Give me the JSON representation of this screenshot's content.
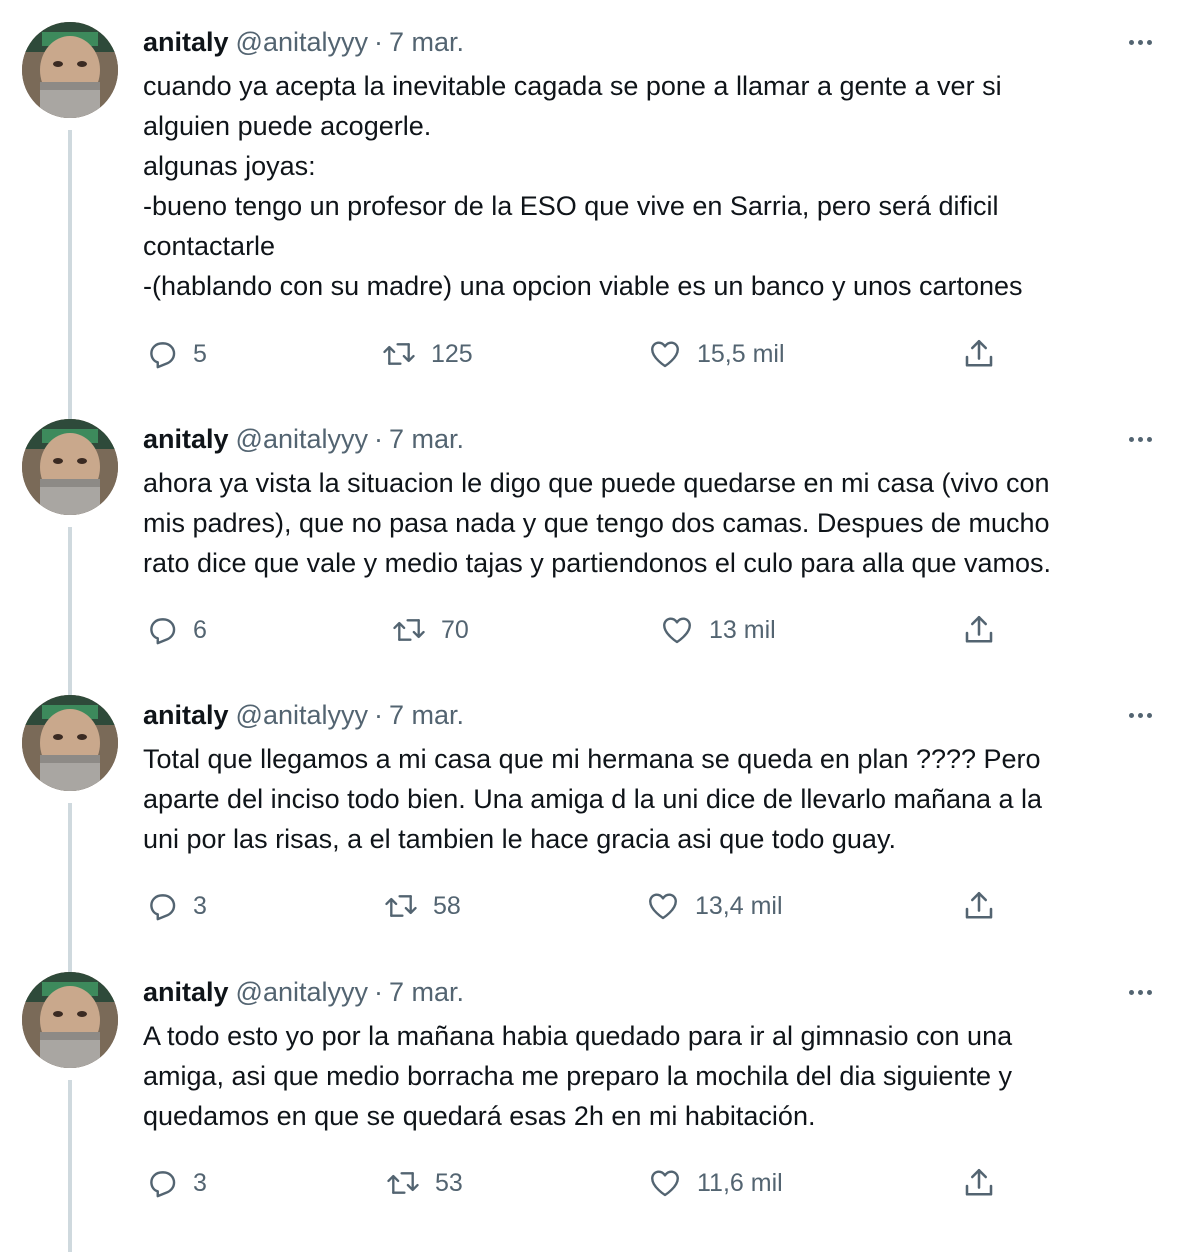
{
  "tweets": [
    {
      "name": "anitaly",
      "handle": "@anitalyyy",
      "separator": "·",
      "date": "7 mar.",
      "text": "cuando ya acepta la inevitable cagada se pone a llamar a gente a ver si\nalguien puede acogerle.\nalgunas joyas:\n-bueno tengo un profesor de la ESO que vive en Sarria, pero será dificil\ncontactarle\n-(hablando con su madre) una opcion viable es un banco y unos cartones",
      "replies": "5",
      "retweets": "125",
      "likes": "15,5 mil"
    },
    {
      "name": "anitaly",
      "handle": "@anitalyyy",
      "separator": "·",
      "date": "7 mar.",
      "text": "ahora ya vista la situacion le digo que puede quedarse en mi casa (vivo con\nmis padres), que no pasa nada y que tengo dos camas. Despues de mucho\nrato dice que vale y medio tajas y partiendonos el culo para alla que vamos.",
      "replies": "6",
      "retweets": "70",
      "likes": "13 mil"
    },
    {
      "name": "anitaly",
      "handle": "@anitalyyy",
      "separator": "·",
      "date": "7 mar.",
      "text": "Total que llegamos a mi casa que mi hermana se queda en plan ???? Pero\naparte del inciso todo bien. Una amiga d la uni dice de llevarlo mañana a la\nuni por las risas, a el tambien le hace gracia asi que todo guay.",
      "replies": "3",
      "retweets": "58",
      "likes": "13,4 mil"
    },
    {
      "name": "anitaly",
      "handle": "@anitalyyy",
      "separator": "·",
      "date": "7 mar.",
      "text": "A todo esto yo por la mañana habia quedado para ir al gimnasio con una\namiga, asi que medio borracha me preparo la mochila del dia siguiente y\nquedamos en que se quedará esas 2h en mi habitación.",
      "replies": "3",
      "retweets": "53",
      "likes": "11,6 mil"
    }
  ],
  "icons": {
    "reply": "reply-icon",
    "retweet": "retweet-icon",
    "like": "heart-icon",
    "share": "share-icon",
    "more": "more-icon"
  },
  "colors": {
    "text": "#0f1419",
    "secondary": "#536471",
    "thread_line": "#cfd9de"
  }
}
